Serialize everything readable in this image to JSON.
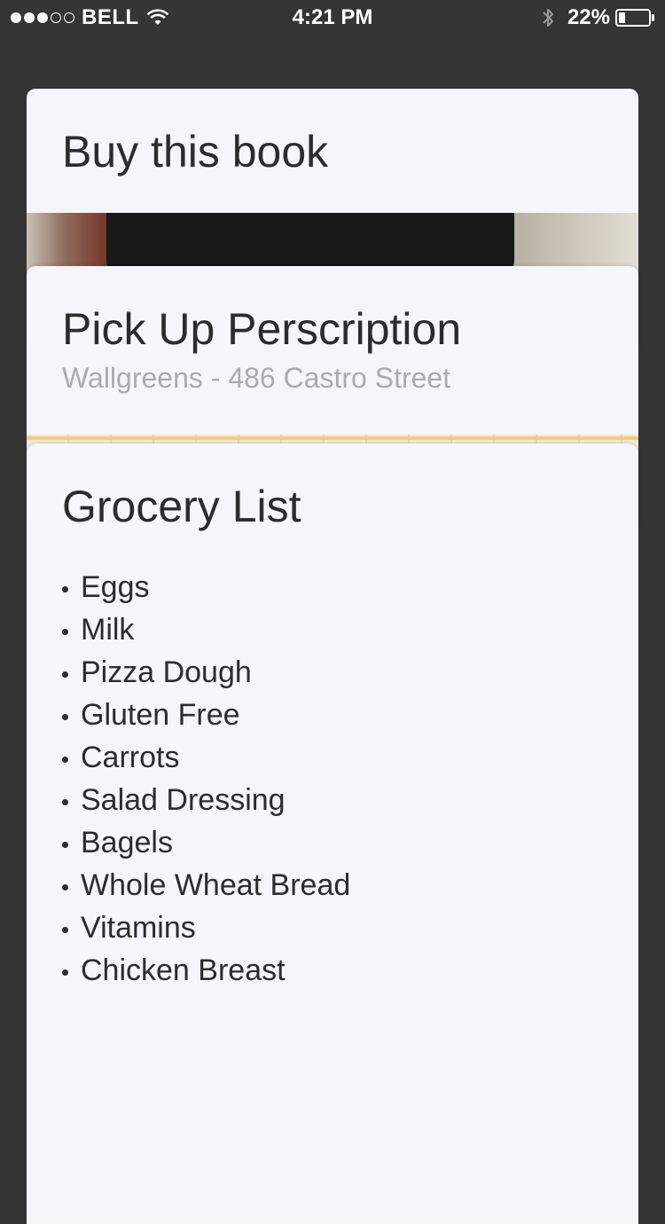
{
  "status_bar": {
    "carrier": "BELL",
    "signal_filled": 3,
    "signal_total": 5,
    "time": "4:21 PM",
    "battery_percent_label": "22%",
    "battery_level": 0.22
  },
  "cards": {
    "book": {
      "title": "Buy this book"
    },
    "prescription": {
      "title": "Pick Up Perscription",
      "subtitle": "Wallgreens - 486 Castro Street"
    },
    "grocery": {
      "title": "Grocery List",
      "items": [
        "Eggs",
        "Milk",
        "Pizza Dough",
        "Gluten Free",
        "Carrots",
        "Salad Dressing",
        "Bagels",
        "Whole Wheat Bread",
        "Vitamins",
        "Chicken Breast"
      ]
    }
  },
  "colors": {
    "background": "#353535",
    "card": "#f5f6f9",
    "title_text": "#2c2c2c",
    "subtitle_text": "#a9abae"
  }
}
